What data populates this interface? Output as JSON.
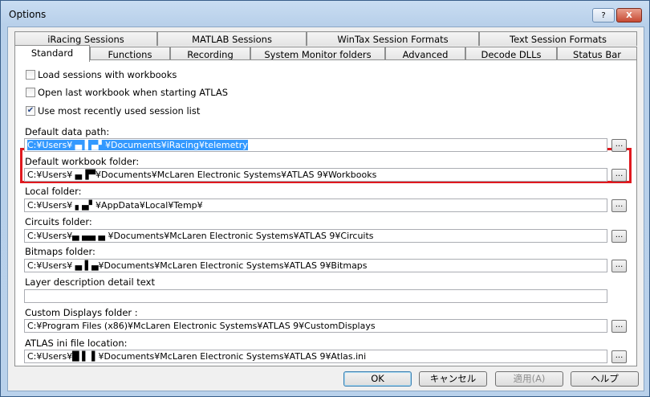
{
  "window": {
    "title": "Options",
    "help_label": "?",
    "close_label": "X"
  },
  "tabs_row1": [
    "iRacing Sessions",
    "MATLAB Sessions",
    "WinTax Session Formats",
    "Text Session Formats"
  ],
  "tabs_row2": [
    "Standard",
    "Functions",
    "Recording",
    "System Monitor folders",
    "Advanced",
    "Decode DLLs",
    "Status Bar"
  ],
  "checkboxes": [
    {
      "label": "Load sessions with workbooks",
      "checked": false
    },
    {
      "label": "Open last workbook when starting ATLAS",
      "checked": false
    },
    {
      "label": "Use most recently used session list",
      "checked": true
    }
  ],
  "fields": [
    {
      "label": "Default data path:",
      "value": "C:¥Users¥ ▄ ▌▄▘¥Documents¥iRacing¥telemetry"
    },
    {
      "label": "Default workbook folder:",
      "value": "C:¥Users¥ ▄▐▀¥Documents¥McLaren Electronic Systems¥ATLAS 9¥Workbooks"
    },
    {
      "label": "Local folder:",
      "value": "C:¥Users¥ ▖▄▘¥AppData¥Local¥Temp¥"
    },
    {
      "label": "Circuits folder:",
      "value": "C:¥Users¥▄ ▄▄ ▄ ¥Documents¥McLaren Electronic Systems¥ATLAS 9¥Circuits"
    },
    {
      "label": "Bitmaps folder:",
      "value": "C:¥Users¥ ▄ ▌▄¥Documents¥McLaren Electronic Systems¥ATLAS 9¥Bitmaps"
    },
    {
      "label": "Layer description detail text",
      "value": ""
    },
    {
      "label": "Custom Displays folder :",
      "value": "C:¥Program Files (x86)¥McLaren Electronic Systems¥ATLAS 9¥CustomDisplays"
    },
    {
      "label": "ATLAS ini file location:",
      "value": "C:¥Users¥█ ▌ ▌¥Documents¥McLaren Electronic Systems¥ATLAS 9¥Atlas.ini"
    }
  ],
  "browse_label": "...",
  "buttons": {
    "ok": "OK",
    "cancel": "キャンセル",
    "apply": "適用(A)",
    "help": "ヘルプ"
  },
  "colors": {
    "highlight_border": "#e0191f",
    "selection": "#3399ff"
  }
}
